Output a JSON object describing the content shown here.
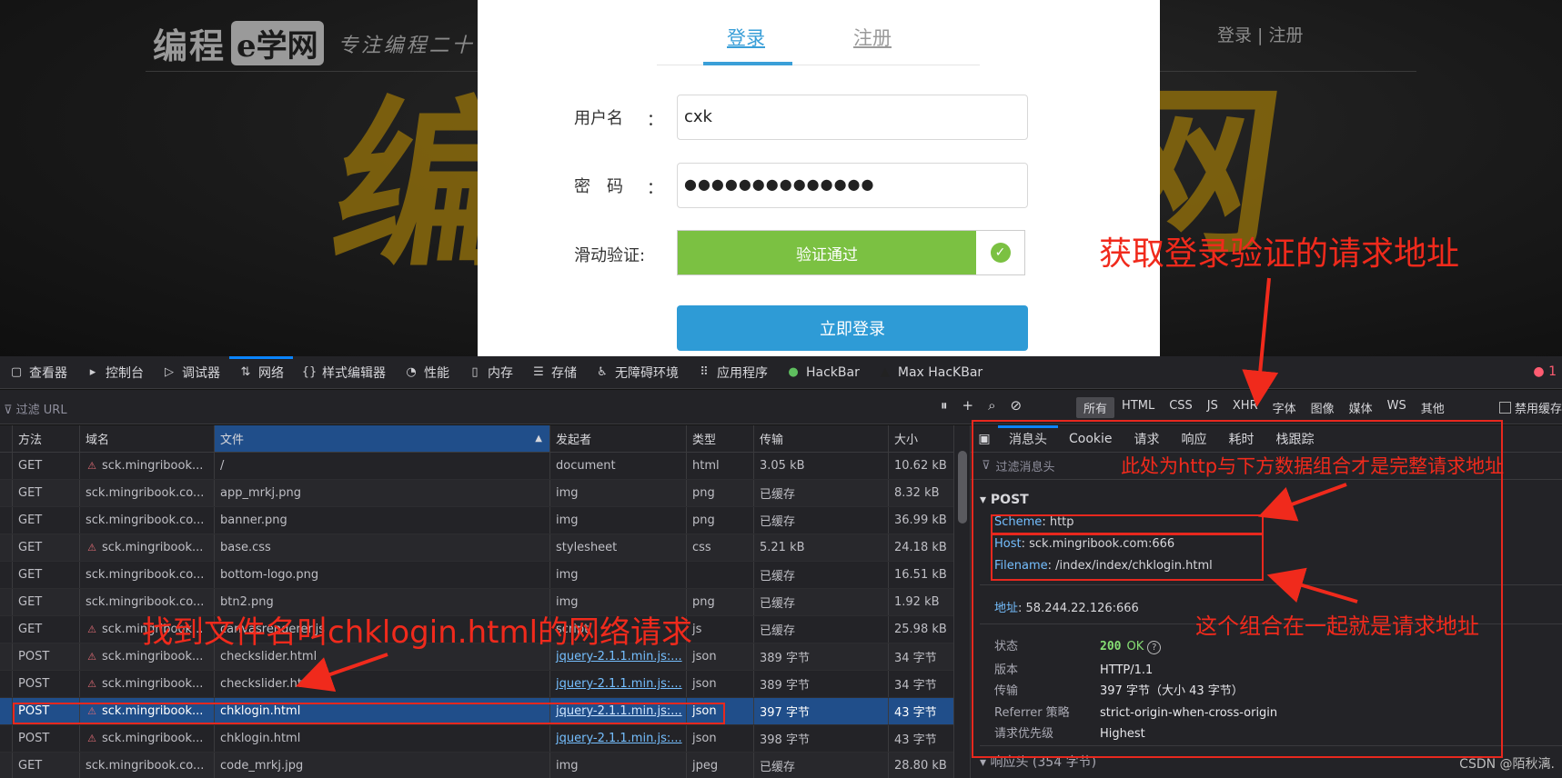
{
  "site": {
    "logo_main": "编程",
    "logo_badge": "e学网",
    "logo_slogan": "专注编程二十",
    "big_left": "编",
    "big_right": "网",
    "auth_links": "登录 | 注册"
  },
  "login": {
    "tab_login": "登录",
    "tab_register": "注册",
    "username_label": "用户名",
    "username_value": "cxk",
    "password_label": "密　码",
    "password_value": "●●●●●●●●●●●●●●",
    "slider_label": "滑动验证:",
    "slider_text": "验证通过",
    "submit": "立即登录",
    "colon": "："
  },
  "devtools": {
    "tabs": [
      {
        "label": "查看器",
        "icon": "▢"
      },
      {
        "label": "控制台",
        "icon": "▸"
      },
      {
        "label": "调试器",
        "icon": "▷"
      },
      {
        "label": "网络",
        "icon": "⇅"
      },
      {
        "label": "样式编辑器",
        "icon": "{}"
      },
      {
        "label": "性能",
        "icon": "◔"
      },
      {
        "label": "内存",
        "icon": "▯"
      },
      {
        "label": "存储",
        "icon": "☰"
      },
      {
        "label": "无障碍环境",
        "icon": "♿"
      },
      {
        "label": "应用程序",
        "icon": "⠿"
      },
      {
        "label": "HackBar",
        "icon": "●"
      },
      {
        "label": "Max HacKBar",
        "icon": "▲"
      }
    ],
    "error_count": "1",
    "filter_placeholder": "过滤 URL",
    "type_filters": [
      "所有",
      "HTML",
      "CSS",
      "JS",
      "XHR",
      "字体",
      "图像",
      "媒体",
      "WS",
      "其他"
    ],
    "disable_cache": "禁用缓存"
  },
  "table": {
    "headers": [
      "方法",
      "域名",
      "文件",
      "发起者",
      "类型",
      "传输",
      "大小"
    ],
    "rows": [
      {
        "method": "GET",
        "domain": "sck.mingribook...",
        "file": "/",
        "initiator": "document",
        "type": "html",
        "transfer": "3.05 kB",
        "size": "10.62 kB"
      },
      {
        "method": "GET",
        "domain": "sck.mingribook.co...",
        "file": "app_mrkj.png",
        "initiator": "img",
        "type": "png",
        "transfer": "已缓存",
        "size": "8.32 kB"
      },
      {
        "method": "GET",
        "domain": "sck.mingribook.co...",
        "file": "banner.png",
        "initiator": "img",
        "type": "png",
        "transfer": "已缓存",
        "size": "36.99 kB"
      },
      {
        "method": "GET",
        "domain": "sck.mingribook...",
        "file": "base.css",
        "initiator": "stylesheet",
        "type": "css",
        "transfer": "5.21 kB",
        "size": "24.18 kB"
      },
      {
        "method": "GET",
        "domain": "sck.mingribook.co...",
        "file": "bottom-logo.png",
        "initiator": "img",
        "type": "",
        "transfer": "已缓存",
        "size": "16.51 kB"
      },
      {
        "method": "GET",
        "domain": "sck.mingribook.co...",
        "file": "btn2.png",
        "initiator": "img",
        "type": "png",
        "transfer": "已缓存",
        "size": "1.92 kB"
      },
      {
        "method": "GET",
        "domain": "sck.mingribook...",
        "file": "canvasrenderer.js",
        "initiator": "script",
        "type": "js",
        "transfer": "已缓存",
        "size": "25.98 kB"
      },
      {
        "method": "POST",
        "domain": "sck.mingribook...",
        "file": "checkslider.html",
        "initiator": "jquery-2.1.1.min.js:...",
        "type": "json",
        "transfer": "389 字节",
        "size": "34 字节"
      },
      {
        "method": "POST",
        "domain": "sck.mingribook...",
        "file": "checkslider.html",
        "initiator": "jquery-2.1.1.min.js:...",
        "type": "json",
        "transfer": "389 字节",
        "size": "34 字节"
      },
      {
        "method": "POST",
        "domain": "sck.mingribook...",
        "file": "chklogin.html",
        "initiator": "jquery-2.1.1.min.js:...",
        "type": "json",
        "transfer": "397 字节",
        "size": "43 字节"
      },
      {
        "method": "POST",
        "domain": "sck.mingribook...",
        "file": "chklogin.html",
        "initiator": "jquery-2.1.1.min.js:...",
        "type": "json",
        "transfer": "398 字节",
        "size": "43 字节"
      },
      {
        "method": "GET",
        "domain": "sck.mingribook.co...",
        "file": "code_mrkj.jpg",
        "initiator": "img",
        "type": "jpeg",
        "transfer": "已缓存",
        "size": "28.80 kB"
      }
    ]
  },
  "detail": {
    "tabs": [
      "消息头",
      "Cookie",
      "请求",
      "响应",
      "耗时",
      "栈跟踪"
    ],
    "filter_placeholder": "过滤消息头",
    "section": "POST",
    "scheme_key": "Scheme",
    "scheme_val": "http",
    "host_key": "Host",
    "host_val": "sck.mingribook.com:666",
    "filename_key": "Filename",
    "filename_val": "/index/index/chklogin.html",
    "address_key": "地址",
    "address_val": "58.244.22.126:666",
    "status_key": "状态",
    "status_code": "200",
    "status_text": "OK",
    "version_key": "版本",
    "version_val": "HTTP/1.1",
    "transfer_key": "传输",
    "transfer_val": "397 字节（大小 43 字节）",
    "referrer_key": "Referrer 策略",
    "referrer_val": "strict-origin-when-cross-origin",
    "priority_key": "请求优先级",
    "priority_val": "Highest",
    "response_headers": "响应头 (354 字节)"
  },
  "annotations": {
    "top_right": "获取登录验证的请求地址",
    "scheme_note": "此处为http与下方数据组合才是完整请求地址",
    "combo_note": "这个组合在一起就是请求地址",
    "table_note": "找到文件名叫chklogin.html的网络请求"
  },
  "watermark": "CSDN @陌秋漓."
}
